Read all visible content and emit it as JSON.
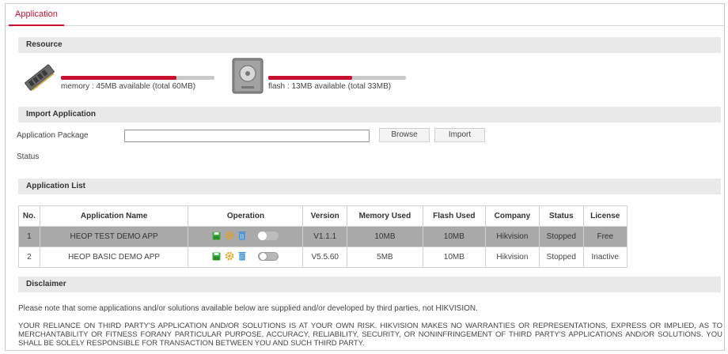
{
  "tabs": [
    {
      "label": "Application"
    }
  ],
  "resource": {
    "title": "Resource",
    "memory": {
      "label": "memory : 45MB available (total 60MB)",
      "used_fraction": 0.75
    },
    "flash": {
      "label": "flash : 13MB available (total 33MB)",
      "used_fraction": 0.61
    }
  },
  "import": {
    "title": "Import Application",
    "package_label": "Application Package",
    "package_value": "",
    "browse_label": "Browse",
    "import_label": "Import",
    "status_label": "Status"
  },
  "app_list": {
    "title": "Application List",
    "headers": [
      "No.",
      "Application Name",
      "Operation",
      "Version",
      "Memory Used",
      "Flash Used",
      "Company",
      "Status",
      "License"
    ],
    "rows": [
      {
        "no": "1",
        "name": "HEOP TEST DEMO APP",
        "version": "V1.1.1",
        "memory": "10MB",
        "flash": "10MB",
        "company": "Hikvision",
        "status": "Stopped",
        "license": "Free",
        "selected": true
      },
      {
        "no": "2",
        "name": "HEOP BASIC DEMO APP",
        "version": "V5.5.60",
        "memory": "5MB",
        "flash": "10MB",
        "company": "Hikvision",
        "status": "Stopped",
        "license": "Inactive",
        "selected": false
      }
    ]
  },
  "disclaimer": {
    "title": "Disclaimer",
    "line1": "Please note that some applications and/or solutions available below are supplied and/or developed by third parties, not HIKVISION.",
    "line2": "YOUR RELIANCE ON THIRD PARTY'S APPLICATION AND/OR SOLUTIONS IS AT YOUR OWN RISK. HIKVISION MAKES NO WARRANTIES OR REPRESENTATIONS, EXPRESS OR IMPLIED, AS TO MERCHANTABILITY OR FITNESS FORANY PARTICULAR PURPOSE, ACCURACY, RELIABILITY, SECURITY, OR NONINFRINGEMENT OF THIRD PARTY'S APPLICATIONS AND/OR SOLUTIONS. YOU SHALL BE SOLELY RESPONSIBLE FOR TRANSACTION BETWEEN YOU AND SUCH THIRD PARTY."
  },
  "colors": {
    "accent": "#c8102e",
    "inactive": "#d6001c",
    "save_icon": "#3aa83a",
    "gear_icon": "#e0a020",
    "delete_icon": "#3a8fd6"
  },
  "icons": {
    "memory": "memory-stick-icon",
    "flash": "flash-drive-icon",
    "save": "save-icon",
    "config": "gear-icon",
    "delete": "trash-icon",
    "toggle": "toggle-switch"
  }
}
